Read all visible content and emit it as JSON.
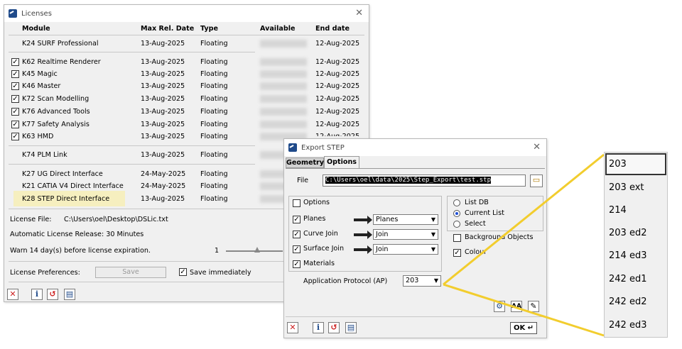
{
  "licenses": {
    "title": "Licenses",
    "headers": {
      "module": "Module",
      "max_rel": "Max Rel. Date",
      "type": "Type",
      "available": "Available",
      "end": "End date"
    },
    "rows": [
      {
        "name": "K24 SURF Professional",
        "date": "13-Aug-2025",
        "type": "Floating",
        "end": "12-Aug-2025"
      },
      {
        "name": "K62 Realtime Renderer",
        "date": "13-Aug-2025",
        "type": "Floating",
        "end": "12-Aug-2025"
      },
      {
        "name": "K45 Magic",
        "date": "13-Aug-2025",
        "type": "Floating",
        "end": "12-Aug-2025"
      },
      {
        "name": "K46 Master",
        "date": "13-Aug-2025",
        "type": "Floating",
        "end": "12-Aug-2025"
      },
      {
        "name": "K72 Scan Modelling",
        "date": "13-Aug-2025",
        "type": "Floating",
        "end": "12-Aug-2025"
      },
      {
        "name": "K76 Advanced Tools",
        "date": "13-Aug-2025",
        "type": "Floating",
        "end": "12-Aug-2025"
      },
      {
        "name": "K77 Safety Analysis",
        "date": "13-Aug-2025",
        "type": "Floating",
        "end": "12-Aug-2025"
      },
      {
        "name": "K63 HMD",
        "date": "13-Aug-2025",
        "type": "Floating",
        "end": "12-Aug-2025"
      },
      {
        "name": "K74 PLM Link",
        "date": "13-Aug-2025",
        "type": "Floating",
        "end": ""
      },
      {
        "name": "K27 UG Direct Interface",
        "date": "24-May-2025",
        "type": "Floating",
        "end": ""
      },
      {
        "name": "K21 CATIA V4 Direct Interface",
        "date": "24-May-2025",
        "type": "Floating",
        "end": ""
      },
      {
        "name": "K28 STEP Direct Interface",
        "date": "13-Aug-2025",
        "type": "Floating",
        "end": ""
      }
    ],
    "license_file_label": "License File:",
    "license_file": "C:\\Users\\oel\\Desktop\\DSLic.txt",
    "auto_release": "Automatic License Release:   30 Minutes",
    "warn": "Warn 14 day(s) before license expiration.",
    "slider_value": "1",
    "prefs_label": "License Preferences:",
    "save_label": "Save",
    "save_immediately": "Save immediately",
    "check": "✓"
  },
  "export": {
    "title": "Export STEP",
    "tab_geometry": "Geometry",
    "tab_options": "Options",
    "file_label": "File",
    "file_value": "C:\\Users\\oel\\data\\2025\\Step_Export\\test.stp",
    "options_label": "Options",
    "planes_label": "Planes",
    "planes_value": "Planes",
    "curve_label": "Curve Join",
    "curve_value": "Join",
    "surface_label": "Surface Join",
    "surface_value": "Join",
    "materials_label": "Materials",
    "list_db": "List DB",
    "current_list": "Current List",
    "select": "Select",
    "background_objects": "Background Objects",
    "colour": "Colour",
    "ap_label": "Application Protocol (AP)",
    "ap_value": "203",
    "ok_label": "OK ↵"
  },
  "dropdown": {
    "options": [
      "203",
      "203 ext",
      "214",
      "203 ed2",
      "214 ed3",
      "242 ed1",
      "242 ed2",
      "242 ed3"
    ],
    "selected": "203"
  },
  "colors": {
    "accent_line": "#f2cd2e",
    "highlight": "#f6efbf",
    "close_red": "#cc1f1f"
  }
}
